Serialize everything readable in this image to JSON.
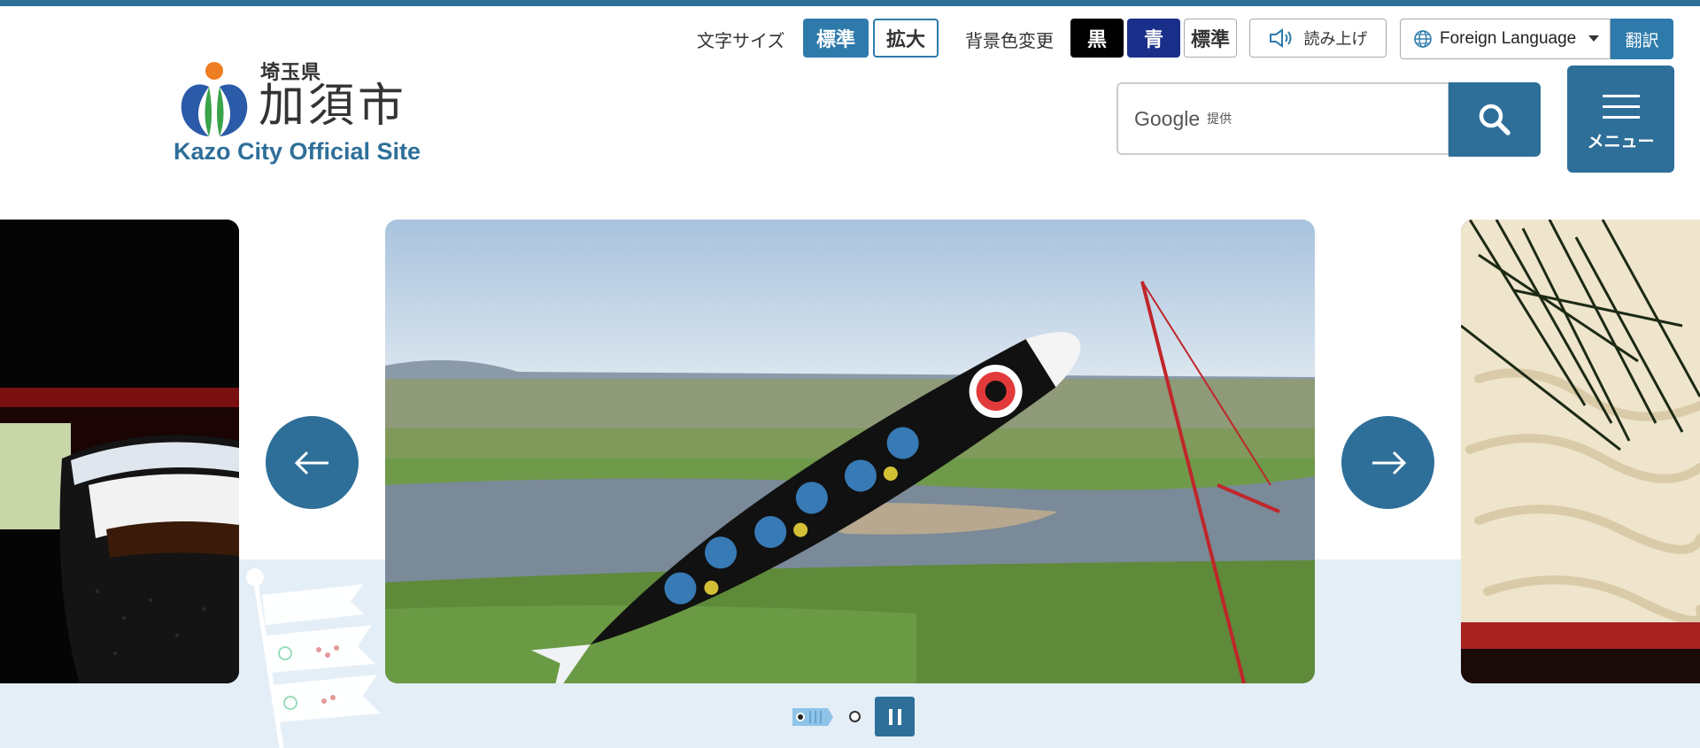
{
  "header": {
    "prefecture": "埼玉県",
    "city": "加須市",
    "site_name": "Kazo City Official Site"
  },
  "utility": {
    "font_size_label": "文字サイズ",
    "font_size_standard": "標準",
    "font_size_large": "拡大",
    "bg_color_label": "背景色変更",
    "bg_black": "黒",
    "bg_blue": "青",
    "bg_standard": "標準",
    "read_aloud": "読み上げ",
    "language_selected": "Foreign Language",
    "translate": "翻訳"
  },
  "search": {
    "brand": "Google",
    "provided": "提供",
    "icon": "search-icon"
  },
  "menu": {
    "label": "メニュー",
    "icon": "hamburger-icon"
  },
  "carousel": {
    "prev_icon": "arrow-left-icon",
    "next_icon": "arrow-right-icon",
    "pause_icon": "pause-icon",
    "slide_count": 2,
    "active_slide": 1
  },
  "colors": {
    "brand": "#2e6f9a",
    "button_blue": "#2e7bab",
    "bg_blue": "#1a2f8a",
    "hero_bg": "#e4eef7"
  }
}
